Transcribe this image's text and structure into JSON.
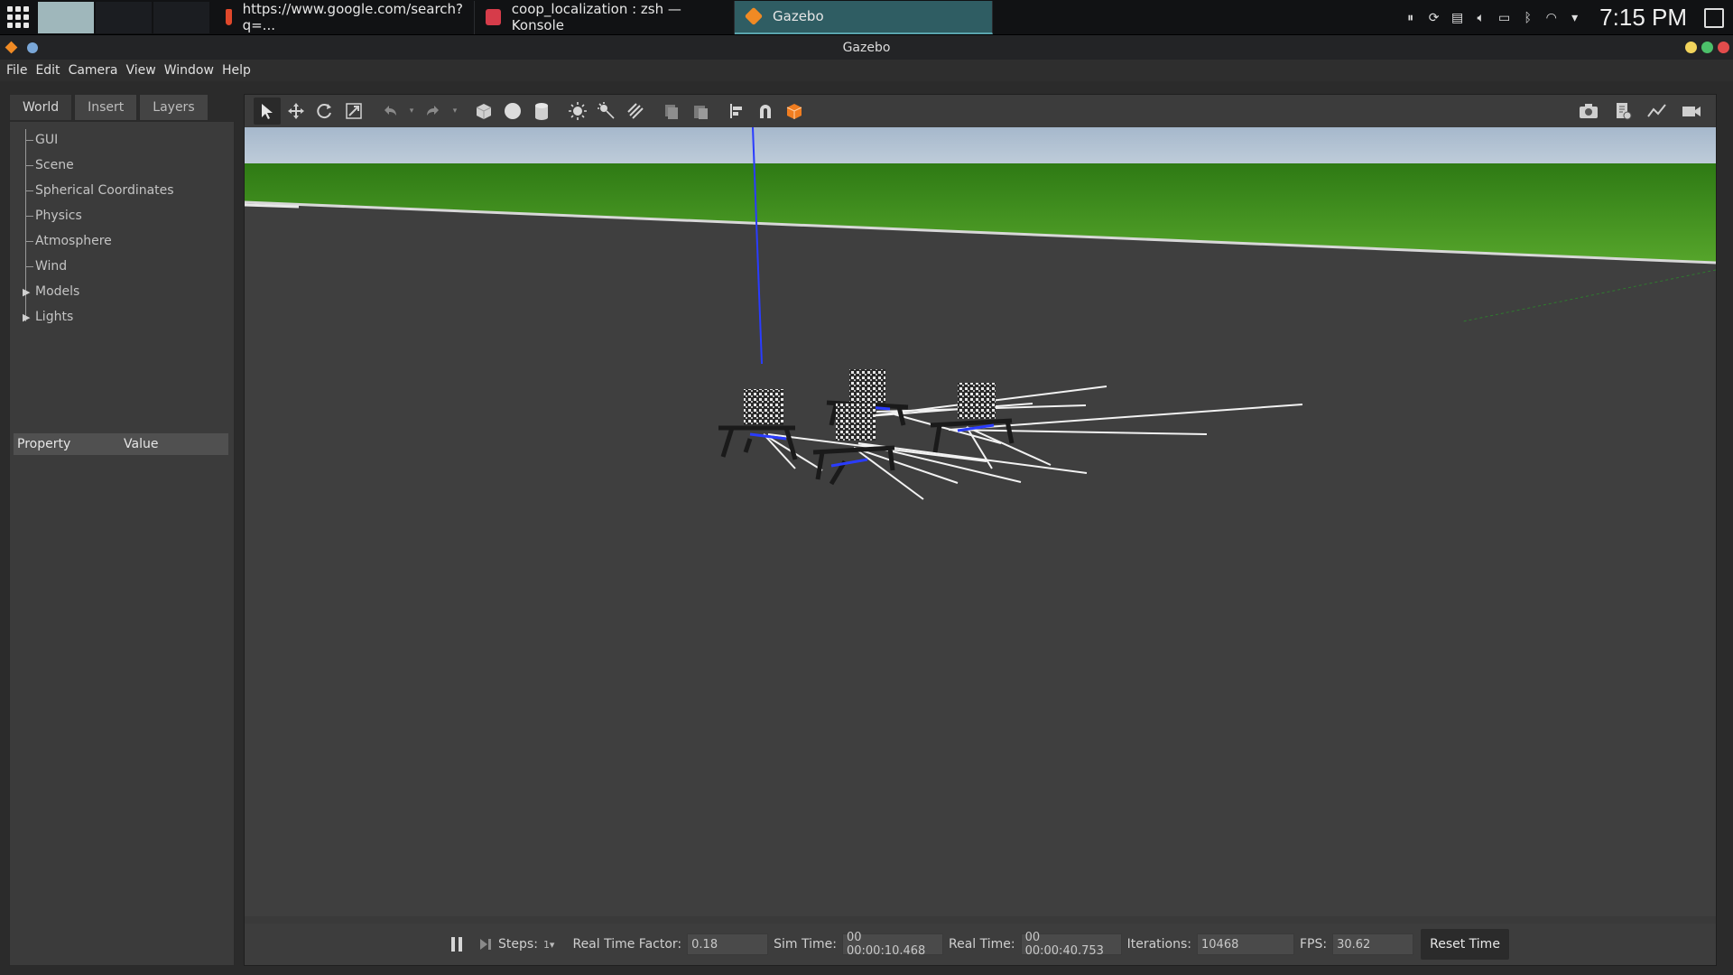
{
  "taskbar": {
    "tasks": [
      {
        "label": "https://www.google.com/search?q=..."
      },
      {
        "label": "coop_localization : zsh — Konsole"
      },
      {
        "label": "Gazebo"
      }
    ],
    "clock": "7:15 PM"
  },
  "window": {
    "title": "Gazebo"
  },
  "menu": [
    "File",
    "Edit",
    "Camera",
    "View",
    "Window",
    "Help"
  ],
  "left_panel": {
    "tabs": [
      "World",
      "Insert",
      "Layers"
    ],
    "tree": [
      "GUI",
      "Scene",
      "Spherical Coordinates",
      "Physics",
      "Atmosphere",
      "Wind",
      "Models",
      "Lights"
    ],
    "property_header": {
      "property": "Property",
      "value": "Value"
    }
  },
  "bottom_bar": {
    "steps_label": "Steps:",
    "real_time_factor_label": "Real Time Factor:",
    "real_time_factor": "0.18",
    "sim_time_label": "Sim Time:",
    "sim_time": "00 00:00:10.468",
    "real_time_label": "Real Time:",
    "real_time": "00 00:00:40.753",
    "iterations_label": "Iterations:",
    "iterations": "10468",
    "fps_label": "FPS:",
    "fps": "30.62",
    "reset_label": "Reset Time"
  },
  "colors": {
    "accent": "#2f5d63",
    "ground": "#404040",
    "grass": "#3f8f1f",
    "sky": "#b8c9d8"
  }
}
